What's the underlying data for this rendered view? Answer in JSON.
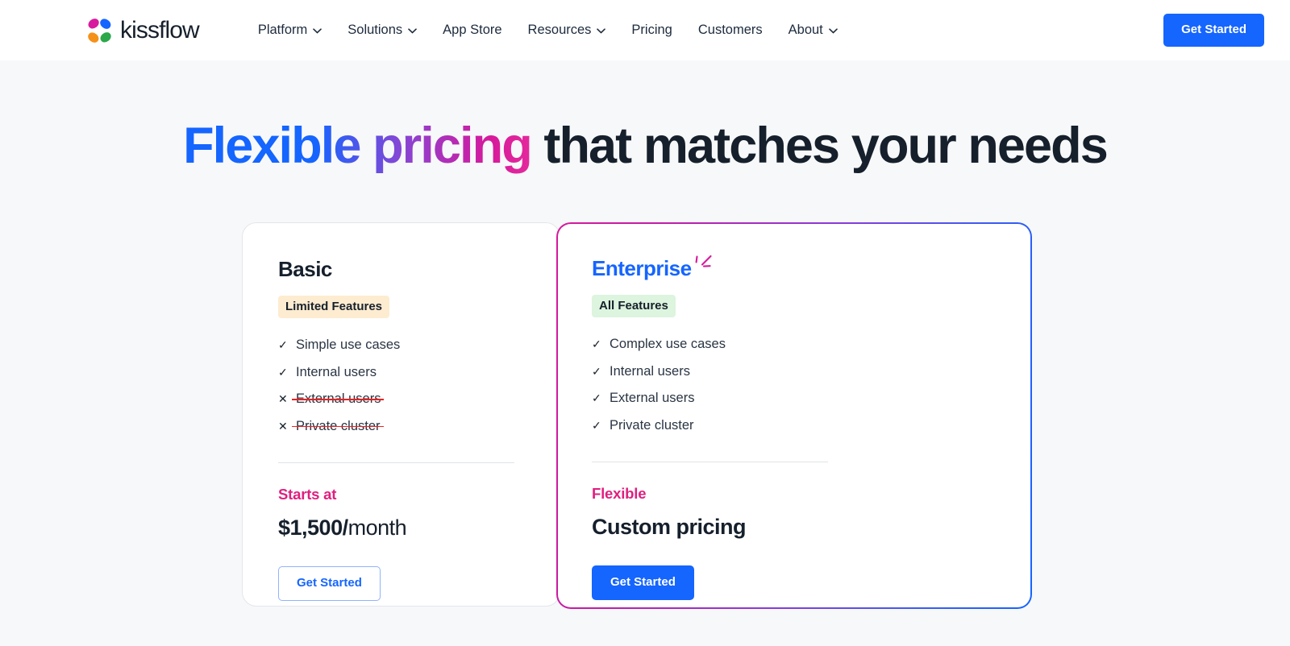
{
  "header": {
    "brand_name": "kissflow",
    "brand_logo_icon": "kissflow-butterfly-logo-icon",
    "nav": [
      {
        "label": "Platform",
        "has_dropdown": true,
        "icon": "chevron-down-icon"
      },
      {
        "label": "Solutions",
        "has_dropdown": true,
        "icon": "chevron-down-icon"
      },
      {
        "label": "App Store",
        "has_dropdown": false,
        "icon": ""
      },
      {
        "label": "Resources",
        "has_dropdown": true,
        "icon": "chevron-down-icon"
      },
      {
        "label": "Pricing",
        "has_dropdown": false,
        "icon": ""
      },
      {
        "label": "Customers",
        "has_dropdown": false,
        "icon": ""
      },
      {
        "label": "About",
        "has_dropdown": true,
        "icon": "chevron-down-icon"
      }
    ],
    "cta_label": "Get Started"
  },
  "hero": {
    "title_gradient_part": "Flexible pricing",
    "title_plain_part": " that matches your needs"
  },
  "pricing": {
    "plans": [
      {
        "name": "Basic",
        "badge": "Limited Features",
        "features": [
          {
            "label": "Simple use cases",
            "included": true,
            "mark": "✓"
          },
          {
            "label": "Internal users",
            "included": true,
            "mark": "✓"
          },
          {
            "label": "External users",
            "included": false,
            "mark": "✕"
          },
          {
            "label": "Private cluster",
            "included": false,
            "mark": "✕"
          }
        ],
        "price_label": "Starts at",
        "price_main": "$1,500/",
        "price_suffix": "month",
        "cta_label": "Get Started"
      },
      {
        "name": "Enterprise",
        "badge": "All Features",
        "sparkle_icon": "sparkle-icon",
        "features": [
          {
            "label": "Complex use cases",
            "included": true,
            "mark": "✓"
          },
          {
            "label": "Internal users",
            "included": true,
            "mark": "✓"
          },
          {
            "label": "External users",
            "included": true,
            "mark": "✓"
          },
          {
            "label": "Private cluster",
            "included": true,
            "mark": "✓"
          }
        ],
        "price_label": "Flexible",
        "price_main": "Custom pricing",
        "price_suffix": "",
        "cta_label": "Get Started"
      }
    ]
  },
  "colors": {
    "brand_blue": "#1565ff",
    "brand_magenta": "#d6199c",
    "accent_pink": "#e01f7f",
    "strike_red": "#f02020",
    "badge_limited_bg": "#fdecd0",
    "badge_all_bg": "#ddf4de",
    "hero_bg": "#f7f8f9",
    "text_dark": "#16202c"
  }
}
